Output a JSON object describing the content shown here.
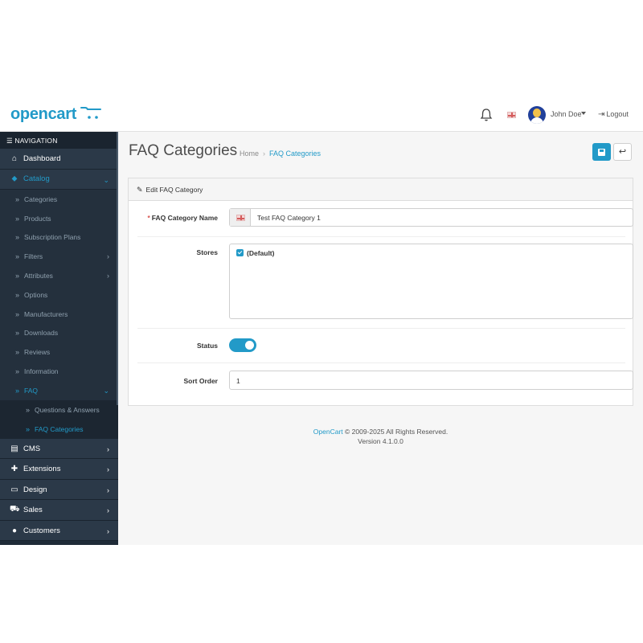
{
  "header": {
    "logo_text": "opencart",
    "user_name": "John Doe",
    "logout_label": "Logout",
    "icons": [
      "bell-icon",
      "flag-uk-icon",
      "avatar",
      "logout-icon",
      "cart-icon"
    ],
    "accent_color": "#229ac8"
  },
  "sidebar": {
    "heading": "NAVIGATION",
    "items": [
      {
        "label": "Dashboard",
        "icon": "home-icon"
      },
      {
        "label": "Catalog",
        "icon": "tag-icon",
        "expanded": true
      },
      {
        "label": "CMS",
        "icon": "newspaper-icon"
      },
      {
        "label": "Extensions",
        "icon": "puzzle-icon"
      },
      {
        "label": "Design",
        "icon": "monitor-icon"
      },
      {
        "label": "Sales",
        "icon": "cart-icon"
      },
      {
        "label": "Customers",
        "icon": "user-icon"
      }
    ],
    "catalog_sub": [
      "Categories",
      "Products",
      "Subscription Plans",
      "Filters",
      "Attributes",
      "Options",
      "Manufacturers",
      "Downloads",
      "Reviews",
      "Information",
      "FAQ"
    ],
    "faq_sub": [
      "Questions & Answers",
      "FAQ Categories"
    ]
  },
  "main": {
    "page_title": "FAQ Categories",
    "breadcrumb": [
      "Home",
      "FAQ Categories"
    ],
    "card_title": "Edit FAQ Category",
    "form": {
      "name_label": "FAQ Category Name",
      "name_value": "Test FAQ Category 1",
      "stores_label": "Stores",
      "store_option": "(Default)",
      "store_checked": true,
      "status_label": "Status",
      "status_enabled": true,
      "sort_label": "Sort Order",
      "sort_value": "1"
    }
  },
  "footer": {
    "brand": "OpenCart",
    "copyright": "© 2009-2025 All Rights Reserved.",
    "version": "Version 4.1.0.0"
  }
}
